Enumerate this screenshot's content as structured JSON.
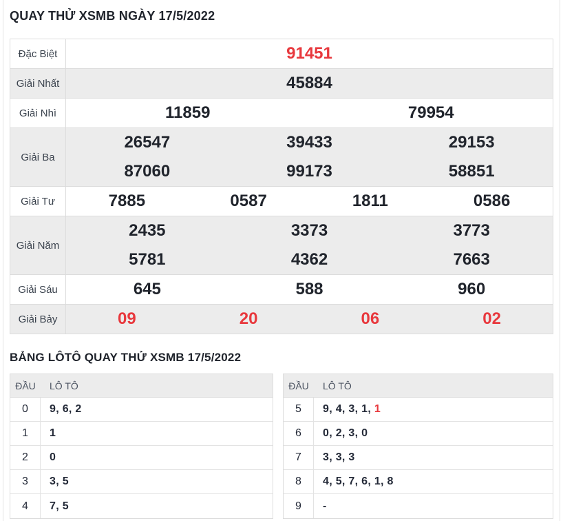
{
  "page": {
    "title": "QUAY THỬ XSMB NGÀY 17/5/2022",
    "lotto_heading": "BẢNG LÔTÔ QUAY THỬ XSMB 17/5/2022"
  },
  "colors": {
    "accent_red": "#e8383d",
    "row_alt_bg": "#ececec",
    "border": "#dcdcdc",
    "text_dark": "#20242c"
  },
  "results_table": {
    "rows": [
      {
        "label": "Đặc Biệt",
        "red": true,
        "lines": [
          [
            "91451"
          ]
        ]
      },
      {
        "label": "Giải Nhất",
        "red": false,
        "lines": [
          [
            "45884"
          ]
        ]
      },
      {
        "label": "Giải Nhì",
        "red": false,
        "lines": [
          [
            "11859",
            "79954"
          ]
        ]
      },
      {
        "label": "Giải Ba",
        "red": false,
        "lines": [
          [
            "26547",
            "39433",
            "29153"
          ],
          [
            "87060",
            "99173",
            "58851"
          ]
        ]
      },
      {
        "label": "Giải Tư",
        "red": false,
        "lines": [
          [
            "7885",
            "0587",
            "1811",
            "0586"
          ]
        ]
      },
      {
        "label": "Giải Năm",
        "red": false,
        "lines": [
          [
            "2435",
            "3373",
            "3773"
          ],
          [
            "5781",
            "4362",
            "7663"
          ]
        ]
      },
      {
        "label": "Giải Sáu",
        "red": false,
        "lines": [
          [
            "645",
            "588",
            "960"
          ]
        ]
      },
      {
        "label": "Giải Bảy",
        "red": true,
        "lines": [
          [
            "09",
            "20",
            "06",
            "02"
          ]
        ]
      }
    ]
  },
  "lotto_tables": [
    {
      "headers": [
        "ĐẦU",
        "LÔ TÔ"
      ],
      "rows": [
        {
          "dau": "0",
          "loto": [
            {
              "t": "9"
            },
            {
              "t": "6"
            },
            {
              "t": "2"
            }
          ]
        },
        {
          "dau": "1",
          "loto": [
            {
              "t": "1"
            }
          ]
        },
        {
          "dau": "2",
          "loto": [
            {
              "t": "0"
            }
          ]
        },
        {
          "dau": "3",
          "loto": [
            {
              "t": "3"
            },
            {
              "t": "5"
            }
          ]
        },
        {
          "dau": "4",
          "loto": [
            {
              "t": "7"
            },
            {
              "t": "5"
            }
          ]
        }
      ]
    },
    {
      "headers": [
        "ĐẦU",
        "LÔ TÔ"
      ],
      "rows": [
        {
          "dau": "5",
          "loto": [
            {
              "t": "9"
            },
            {
              "t": "4"
            },
            {
              "t": "3"
            },
            {
              "t": "1"
            },
            {
              "t": "1",
              "red": true
            }
          ]
        },
        {
          "dau": "6",
          "loto": [
            {
              "t": "0"
            },
            {
              "t": "2"
            },
            {
              "t": "3"
            },
            {
              "t": "0"
            }
          ]
        },
        {
          "dau": "7",
          "loto": [
            {
              "t": "3"
            },
            {
              "t": "3"
            },
            {
              "t": "3"
            }
          ]
        },
        {
          "dau": "8",
          "loto": [
            {
              "t": "4"
            },
            {
              "t": "5"
            },
            {
              "t": "7"
            },
            {
              "t": "6"
            },
            {
              "t": "1"
            },
            {
              "t": "8"
            }
          ]
        },
        {
          "dau": "9",
          "loto": [
            {
              "t": "-"
            }
          ]
        }
      ]
    }
  ]
}
